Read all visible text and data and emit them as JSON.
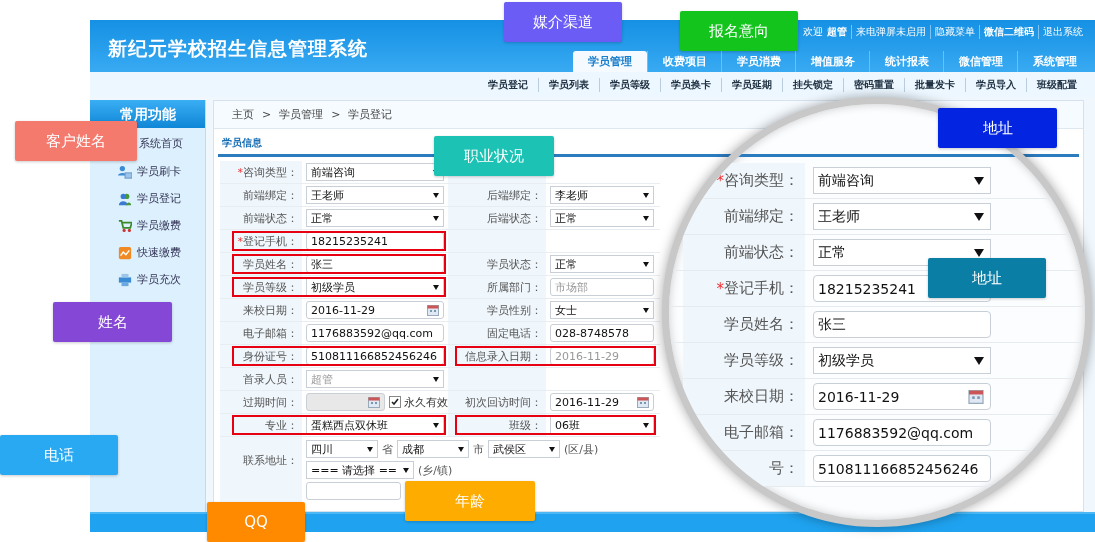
{
  "header": {
    "title": "新纪元学校招生信息管理系统",
    "welcome": "欢迎",
    "user": "超管",
    "links": [
      {
        "label": "来电弹屏未启用",
        "bold": false
      },
      {
        "label": "隐藏菜单",
        "bold": false
      },
      {
        "label": "微信二维码",
        "bold": true
      },
      {
        "label": "退出系统",
        "bold": false
      }
    ]
  },
  "tabs": [
    {
      "label": "学员管理",
      "selected": true
    },
    {
      "label": "收费项目",
      "selected": false
    },
    {
      "label": "学员消费",
      "selected": false
    },
    {
      "label": "增值服务",
      "selected": false
    },
    {
      "label": "统计报表",
      "selected": false
    },
    {
      "label": "微信管理",
      "selected": false
    },
    {
      "label": "系统管理",
      "selected": false
    }
  ],
  "subnav": [
    "学员登记",
    "学员列表",
    "学员等级",
    "学员换卡",
    "学员延期",
    "挂失锁定",
    "密码重置",
    "批量发卡",
    "学员导入",
    "班级配置"
  ],
  "sidebar": {
    "title": "常用功能",
    "items": [
      "系统首页",
      "学员刷卡",
      "学员登记",
      "学员缴费",
      "快速缴费",
      "学员充次"
    ]
  },
  "breadcrumb": {
    "items": [
      "主页",
      "学员管理",
      "学员登记"
    ],
    "separator": ">"
  },
  "section_title": "学员信息",
  "form": {
    "rows": [
      [
        {
          "label": "咨询类型：",
          "required_mark": "*",
          "kind": "select",
          "value": "前端咨询",
          "highlighted": false,
          "disabled": false
        },
        null
      ],
      [
        {
          "label": "前端绑定：",
          "kind": "select",
          "value": "王老师",
          "highlighted": false,
          "disabled": false
        },
        {
          "label": "后端绑定：",
          "kind": "select",
          "value": "李老师",
          "highlighted": false,
          "disabled": false
        }
      ],
      [
        {
          "label": "前端状态：",
          "kind": "select",
          "value": "正常",
          "highlighted": false,
          "disabled": false
        },
        {
          "label": "后端状态：",
          "kind": "select",
          "value": "正常",
          "highlighted": false,
          "disabled": false
        }
      ],
      [
        {
          "label": "登记手机：",
          "required_mark": "*",
          "kind": "input",
          "value": "18215235241",
          "highlighted": true,
          "disabled": false
        },
        null
      ],
      [
        {
          "label": "学员姓名：",
          "kind": "input",
          "value": "张三",
          "highlighted": true,
          "disabled": false
        },
        {
          "label": "学员状态：",
          "kind": "select",
          "value": "正常",
          "highlighted": false,
          "disabled": false
        }
      ],
      [
        {
          "label": "学员等级：",
          "kind": "select",
          "value": "初级学员",
          "highlighted": true,
          "disabled": false
        },
        {
          "label": "所属部门：",
          "kind": "input",
          "value": "市场部",
          "highlighted": false,
          "disabled": true
        }
      ],
      [
        {
          "label": "来校日期：",
          "kind": "date",
          "value": "2016-11-29",
          "highlighted": false,
          "disabled": false
        },
        {
          "label": "学员性别：",
          "kind": "select",
          "value": "女士",
          "highlighted": false,
          "disabled": false
        }
      ],
      [
        {
          "label": "电子邮箱：",
          "kind": "input",
          "value": "1176883592@qq.com",
          "highlighted": false,
          "disabled": false
        },
        {
          "label": "固定电话：",
          "kind": "input",
          "value": "028-8748578",
          "highlighted": false,
          "disabled": false
        }
      ],
      [
        {
          "label": "身份证号：",
          "kind": "input",
          "value": "510811166852456246",
          "highlighted": true,
          "disabled": false
        },
        {
          "label": "信息录入日期：",
          "kind": "input",
          "value": "2016-11-29",
          "highlighted": true,
          "disabled": true
        }
      ],
      [
        {
          "label": "首录人员：",
          "kind": "select",
          "value": "超管",
          "highlighted": false,
          "disabled": true
        },
        null
      ],
      [
        {
          "label": "过期时间：",
          "kind": "date",
          "highlighted": false,
          "disabled": true,
          "checkbox": {
            "label": "永久有效",
            "checked": true
          }
        },
        {
          "label": "初次回访时间：",
          "kind": "date",
          "value": "2016-11-29",
          "highlighted": false,
          "disabled": false
        }
      ],
      [
        {
          "label": "专业：",
          "kind": "select",
          "value": "蛋糕西点双休班",
          "highlighted": true,
          "disabled": false
        },
        {
          "label": "班级：",
          "kind": "select",
          "value": "06班",
          "highlighted": true,
          "disabled": false
        }
      ]
    ],
    "address": {
      "label": "联系地址：",
      "parts": [
        {
          "kind": "select",
          "value": "四川"
        },
        {
          "kind": "text",
          "value": "省"
        },
        {
          "kind": "select",
          "value": "成都"
        },
        {
          "kind": "text",
          "value": "市"
        },
        {
          "kind": "select",
          "value": "武侯区"
        },
        {
          "kind": "text",
          "value": "(区/县)"
        },
        {
          "kind": "select",
          "value": "=== 请选择 =="
        },
        {
          "kind": "text",
          "value": "(乡/镇)"
        }
      ]
    }
  },
  "magnifier": {
    "rows": [
      {
        "label": "咨询类型：",
        "required_mark": "*",
        "kind": "select",
        "value": "前端咨询"
      },
      {
        "label": "前端绑定：",
        "kind": "select",
        "value": "王老师"
      },
      {
        "label": "前端状态：",
        "kind": "select",
        "value": "正常"
      },
      {
        "label": "登记手机：",
        "required_mark": "*",
        "kind": "input",
        "value": "18215235241"
      },
      {
        "label": "学员姓名：",
        "kind": "input",
        "value": "张三"
      },
      {
        "label": "学员等级：",
        "kind": "select",
        "value": "初级学员"
      },
      {
        "label": "来校日期：",
        "kind": "date",
        "value": "2016-11-29"
      },
      {
        "label": "电子邮箱：",
        "kind": "input",
        "value": "1176883592@qq.com"
      },
      {
        "label": "号：",
        "kind": "input",
        "value": "510811166852456246"
      }
    ]
  },
  "annotations": [
    {
      "label": "媒介渠道",
      "color": "#6a5cf5"
    },
    {
      "label": "报名意向",
      "color": "#12c41c"
    },
    {
      "label": "客户姓名",
      "color": "#f47a6e"
    },
    {
      "label": "职业状况",
      "color": "#1cc3b4"
    },
    {
      "label": "地址",
      "color": "#0324e0"
    },
    {
      "label": "地址",
      "color": "#0a7ea4"
    },
    {
      "label": "姓名",
      "color": "#8547d6"
    },
    {
      "label": "电话",
      "color": "#29a9f2"
    },
    {
      "label": "QQ",
      "color": "#ff8a00"
    },
    {
      "label": "年龄",
      "color": "#ffac00"
    }
  ]
}
